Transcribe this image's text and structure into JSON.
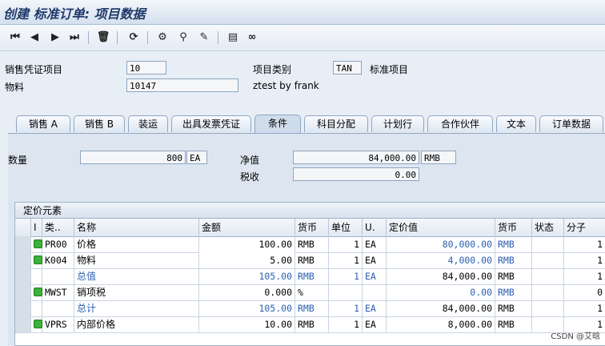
{
  "title": "创建 标准订单: 项目数据",
  "toolbar": {
    "icons": [
      "first-page",
      "prev-page",
      "next-page",
      "last-page",
      "delete",
      "refresh",
      "settings",
      "binoculars",
      "edit",
      "document",
      "glasses"
    ],
    "glyphs": [
      "⏮",
      "◀",
      "▶",
      "⏭",
      "🗑",
      "⟳",
      "⚙",
      "⚲",
      "✎",
      "▤",
      "∞"
    ]
  },
  "header": {
    "item_label": "销售凭证项目",
    "item_value": "10",
    "category_label": "项目类别",
    "category_value": "TAN",
    "category_desc": "标准项目",
    "material_label": "物料",
    "material_value": "10147",
    "material_desc": "ztest by frank"
  },
  "tabs": [
    "销售 A",
    "销售 B",
    "装运",
    "出具发票凭证",
    "条件",
    "科目分配",
    "计划行",
    "合作伙伴",
    "文本",
    "订单数据"
  ],
  "active_tab": "条件",
  "summary": {
    "qty_label": "数量",
    "qty_value": "800",
    "qty_unit": "EA",
    "net_label": "净值",
    "net_value": "84,000.00",
    "net_currency": "RMB",
    "tax_label": "税收",
    "tax_value": "0.00"
  },
  "grid": {
    "title": "定价元素",
    "columns": [
      "I",
      "类..",
      "名称",
      "金额",
      "货币",
      "单位",
      "U.",
      "定价值",
      "货币",
      "状态",
      "分子"
    ],
    "rows": [
      {
        "led": true,
        "type": "PR00",
        "name": "价格",
        "amount": "100.00",
        "cur": "RMB",
        "unit": "1",
        "uom": "EA",
        "cond_value": "80,000.00",
        "cur2": "RMB",
        "status": "",
        "num": "1",
        "blue_name": false,
        "blue_amount": false,
        "blue_value": true
      },
      {
        "led": true,
        "type": "K004",
        "name": "物料",
        "amount": "5.00",
        "cur": "RMB",
        "unit": "1",
        "uom": "EA",
        "cond_value": "4,000.00",
        "cur2": "RMB",
        "status": "",
        "num": "1",
        "blue_name": false,
        "blue_amount": false,
        "blue_value": true
      },
      {
        "led": false,
        "type": "",
        "name": "总值",
        "amount": "105.00",
        "cur": "RMB",
        "unit": "1",
        "uom": "EA",
        "cond_value": "84,000.00",
        "cur2": "RMB",
        "status": "",
        "num": "1",
        "blue_name": true,
        "blue_amount": true,
        "blue_value": false
      },
      {
        "led": true,
        "type": "MWST",
        "name": "销项税",
        "amount": "0.000",
        "cur": "%",
        "unit": "",
        "uom": "",
        "cond_value": "0.00",
        "cur2": "RMB",
        "status": "",
        "num": "0",
        "blue_name": false,
        "blue_amount": false,
        "blue_value": true
      },
      {
        "led": false,
        "type": "",
        "name": "总计",
        "amount": "105.00",
        "cur": "RMB",
        "unit": "1",
        "uom": "EA",
        "cond_value": "84,000.00",
        "cur2": "RMB",
        "status": "",
        "num": "1",
        "blue_name": true,
        "blue_amount": true,
        "blue_value": false
      },
      {
        "led": true,
        "type": "VPRS",
        "name": "内部价格",
        "amount": "10.00",
        "cur": "RMB",
        "unit": "1",
        "uom": "EA",
        "cond_value": "8,000.00",
        "cur2": "RMB",
        "status": "",
        "num": "1",
        "blue_name": false,
        "blue_amount": false,
        "blue_value": false
      }
    ]
  },
  "watermark": "CSDN @艾晗"
}
